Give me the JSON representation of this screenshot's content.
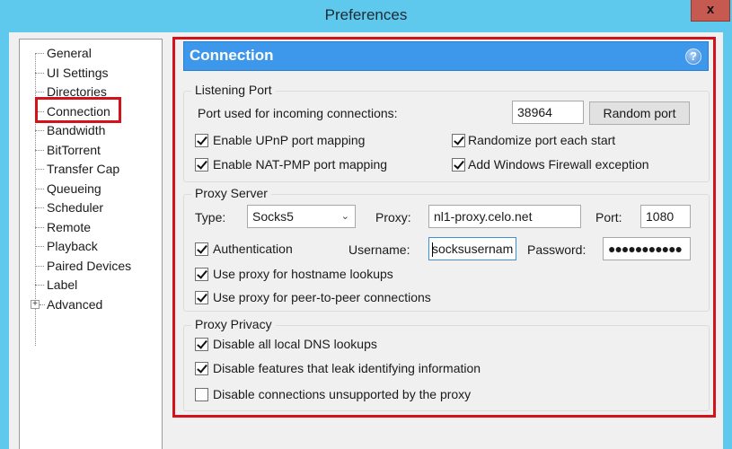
{
  "window": {
    "title": "Preferences",
    "close_label": "x"
  },
  "sidebar": {
    "items": [
      {
        "label": "General"
      },
      {
        "label": "UI Settings"
      },
      {
        "label": "Directories"
      },
      {
        "label": "Connection",
        "selected": true,
        "highlighted": true
      },
      {
        "label": "Bandwidth"
      },
      {
        "label": "BitTorrent"
      },
      {
        "label": "Transfer Cap"
      },
      {
        "label": "Queueing"
      },
      {
        "label": "Scheduler"
      },
      {
        "label": "Remote"
      },
      {
        "label": "Playback"
      },
      {
        "label": "Paired Devices"
      },
      {
        "label": "Label"
      },
      {
        "label": "Advanced",
        "expandable": true,
        "expander": "+"
      }
    ]
  },
  "panel": {
    "title": "Connection",
    "help_icon": "?",
    "listening_port": {
      "group_label": "Listening Port",
      "port_label": "Port used for incoming connections:",
      "port_value": "38964",
      "random_port_button": "Random port",
      "checkboxes": [
        {
          "label": "Enable UPnP port mapping",
          "checked": true
        },
        {
          "label": "Randomize port each start",
          "checked": true
        },
        {
          "label": "Enable NAT-PMP port mapping",
          "checked": true
        },
        {
          "label": "Add Windows Firewall exception",
          "checked": true
        }
      ]
    },
    "proxy_server": {
      "group_label": "Proxy Server",
      "type_label": "Type:",
      "type_value": "Socks5",
      "proxy_label": "Proxy:",
      "proxy_value": "nl1-proxy.celo.net",
      "port_label": "Port:",
      "port_value": "1080",
      "authentication": {
        "label": "Authentication",
        "checked": true
      },
      "username_label": "Username:",
      "username_value": "socksusernam",
      "password_label": "Password:",
      "password_value": "●●●●●●●●●●●",
      "checkboxes": [
        {
          "label": "Use proxy for hostname lookups",
          "checked": true
        },
        {
          "label": "Use proxy for peer-to-peer connections",
          "checked": true
        }
      ]
    },
    "proxy_privacy": {
      "group_label": "Proxy Privacy",
      "checkboxes": [
        {
          "label": "Disable all local DNS lookups",
          "checked": true
        },
        {
          "label": "Disable features that leak identifying information",
          "checked": true
        },
        {
          "label": "Disable connections unsupported by the proxy",
          "checked": false
        }
      ]
    }
  },
  "colors": {
    "titlebar": "#5ec9ec",
    "header_bar": "#3d97ea",
    "highlight_red": "#d4121c",
    "close_button": "#c75a50"
  }
}
